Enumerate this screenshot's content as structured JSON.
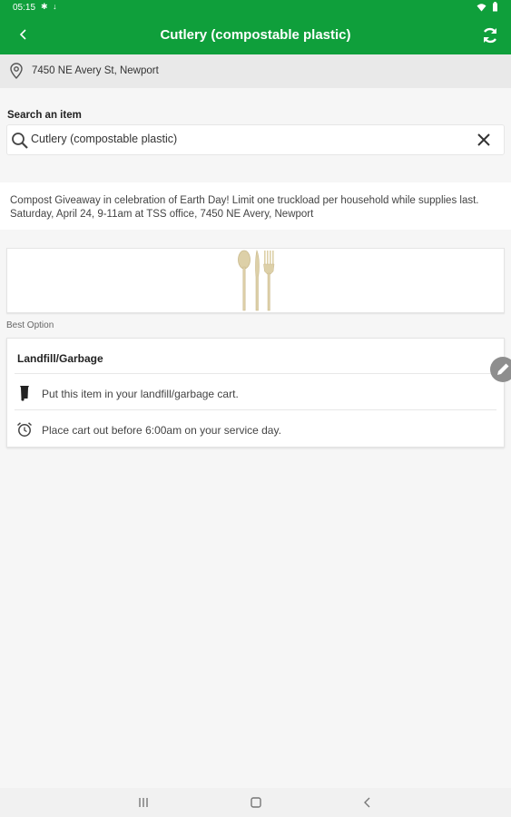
{
  "status_bar": {
    "time": "05:15",
    "left_icons": [
      "settings-icon",
      "download-icon"
    ],
    "right_icons": [
      "wifi-icon",
      "battery-icon"
    ]
  },
  "app_bar": {
    "title": "Cutlery (compostable plastic)",
    "back_icon": "back-arrow-icon",
    "refresh_icon": "refresh-icon",
    "color": "#0f9f3b"
  },
  "address": {
    "icon": "location-pin-icon",
    "text": "7450 NE Avery St, Newport"
  },
  "search": {
    "label": "Search an item",
    "value": "Cutlery (compostable plastic)",
    "search_icon": "search-icon",
    "clear_icon": "close-icon"
  },
  "notice": {
    "text": "Compost Giveaway in celebration of Earth Day! Limit one truckload per household while supplies last. Saturday, April 24, 9-11am at TSS office, 7450 NE Avery, Newport"
  },
  "item_image": {
    "icon": "cutlery-icon"
  },
  "best_option": {
    "label": "Best Option",
    "heading": "Landfill/Garbage",
    "instructions": [
      {
        "icon": "garbage-cart-icon",
        "text": "Put this item in your landfill/garbage cart."
      },
      {
        "icon": "alarm-clock-icon",
        "text": "Place cart out before 6:00am on your service day."
      }
    ]
  },
  "fab": {
    "icon": "pencil-icon"
  },
  "nav_bar": {
    "items": [
      "recents-icon",
      "home-icon",
      "back-icon"
    ]
  }
}
